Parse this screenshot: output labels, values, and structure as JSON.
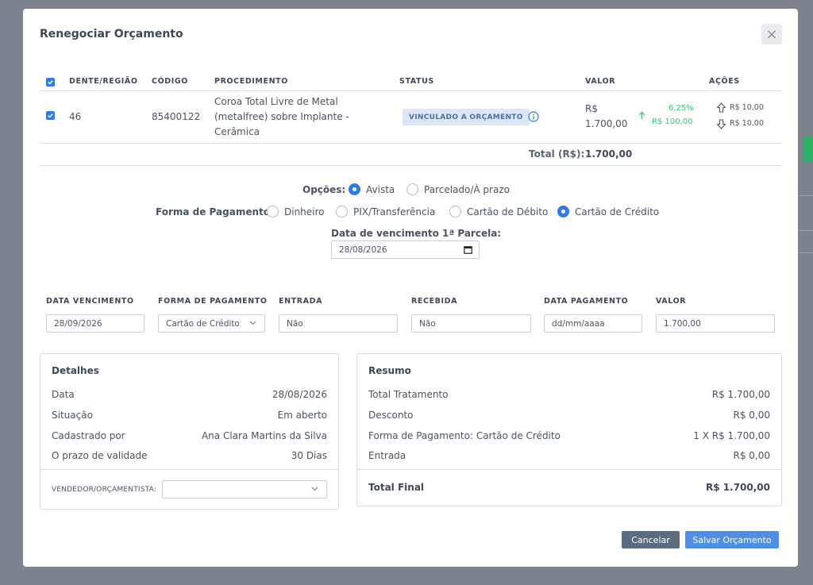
{
  "modal": {
    "title": "Renegociar Orçamento",
    "close_label": "×"
  },
  "table": {
    "headers": {
      "tooth": "DENTE/REGIÃO",
      "code": "CÓDIGO",
      "procedure": "PROCEDIMENTO",
      "status": "STATUS",
      "value": "VALOR",
      "actions": "AÇÕES"
    },
    "row": {
      "tooth": "46",
      "code": "85400122",
      "procedure_line1": "Coroa Total Livre de Metal",
      "procedure_line2": "(metalfree) sobre Implante -",
      "procedure_line3": "Cerâmica",
      "status": "VINCULADO A ORÇAMENTO",
      "value_line1": "R$",
      "value_line2": "1.700,00",
      "increase_percent": "6,25%",
      "increase_value": "R$  100,00",
      "action_up": "R$ 10,00",
      "action_down": "R$ 10,00"
    },
    "total_label": "Total (R$):",
    "total_value": "1.700,00"
  },
  "options": {
    "label": "Opções:",
    "choices": [
      "Avista",
      "Parcelado/À prazo"
    ],
    "selected": "Avista"
  },
  "payment": {
    "label": "Forma de Pagamento:",
    "choices": [
      "Dinheiro",
      "PIX/Transferência",
      "Cartão de Débito",
      "Cartão de Crédito"
    ],
    "selected": "Cartão de Crédito"
  },
  "first_due": {
    "label": "Data de vencimento 1ª Parcela:",
    "value": "28/08/2026"
  },
  "installments": {
    "headers": {
      "due_date": "DATA VENCIMENTO",
      "payment_method": "FORMA DE PAGAMENTO",
      "entry": "ENTRADA",
      "received": "RECEBIDA",
      "payment_date": "DATA PAGAMENTO",
      "value": "VALOR"
    },
    "row": {
      "due_date": "28/09/2026",
      "payment_method": "Cartão de Crédito",
      "entry": "Não",
      "received": "Não",
      "payment_date": "dd/mm/aaaa",
      "value": "1.700,00"
    }
  },
  "details": {
    "title": "Detalhes",
    "rows": [
      {
        "label": "Data",
        "value": "28/08/2026"
      },
      {
        "label": "Situação",
        "value": "Em aberto"
      },
      {
        "label": "Cadastrado por",
        "value": "Ana Clara Martins da Silva"
      },
      {
        "label": "O prazo de validade",
        "value": "30 Dias"
      }
    ],
    "seller_label": "VENDEDOR/ORÇAMENTISTA:",
    "seller_value": ""
  },
  "summary": {
    "title": "Resumo",
    "rows": [
      {
        "label": "Total Tratamento",
        "value": "R$ 1.700,00"
      },
      {
        "label": "Desconto",
        "value": "R$  0,00"
      },
      {
        "label": "Forma de Pagamento: Cartão de Crédito",
        "value": "1 X R$ 1.700,00"
      },
      {
        "label": "Entrada",
        "value": "R$  0,00"
      }
    ],
    "final_label": "Total Final",
    "final_value": "R$  1.700,00"
  },
  "buttons": {
    "cancel": "Cancelar",
    "save": "Salvar Orçamento"
  },
  "colors": {
    "primary": "#2f7be5",
    "save_button": "#4f8fe8",
    "cancel_button": "#5b6b80",
    "positive": "#2ecc71",
    "badge_bg": "#dbe7f6"
  }
}
